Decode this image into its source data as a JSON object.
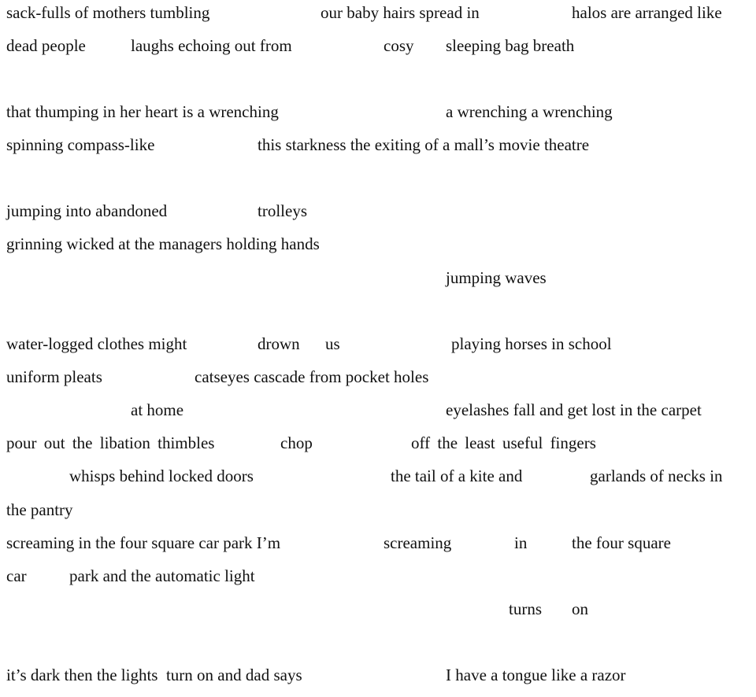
{
  "poem": {
    "lines": [
      [
        "sack-fulls of mothers tumbling",
        "our baby hairs spread in",
        "halos are arranged like"
      ],
      [
        "dead people",
        "laughs echoing out from",
        "cosy",
        "sleeping bag breath"
      ],
      [
        "that thumping in her heart is a wrenching",
        "a wrenching a wrenching"
      ],
      [
        "spinning compass-like",
        "this starkness the exiting of a mall’s movie theatre"
      ],
      [
        "jumping into abandoned",
        "trolleys"
      ],
      [
        "grinning wicked at the managers holding hands"
      ],
      [
        "jumping waves"
      ],
      [
        "water-logged clothes might",
        "drown",
        "us",
        "playing horses in school"
      ],
      [
        "uniform pleats",
        "catseyes cascade from pocket holes"
      ],
      [
        "at home",
        "eyelashes fall and get lost in the carpet"
      ],
      [
        "pour out the libation thimbles",
        "chop",
        "off the least useful fingers"
      ],
      [
        "whisps behind locked doors",
        "the tail of a kite and",
        "garlands of necks in"
      ],
      [
        "the pantry"
      ],
      [
        "screaming in the four square car park I’m",
        "screaming",
        "in",
        "the four square"
      ],
      [
        "car",
        "park and the automatic light"
      ],
      [
        "turns",
        "on"
      ],
      [
        "it’s dark then the lights  turn on and dad says",
        "I have a tongue like a razor"
      ]
    ]
  }
}
